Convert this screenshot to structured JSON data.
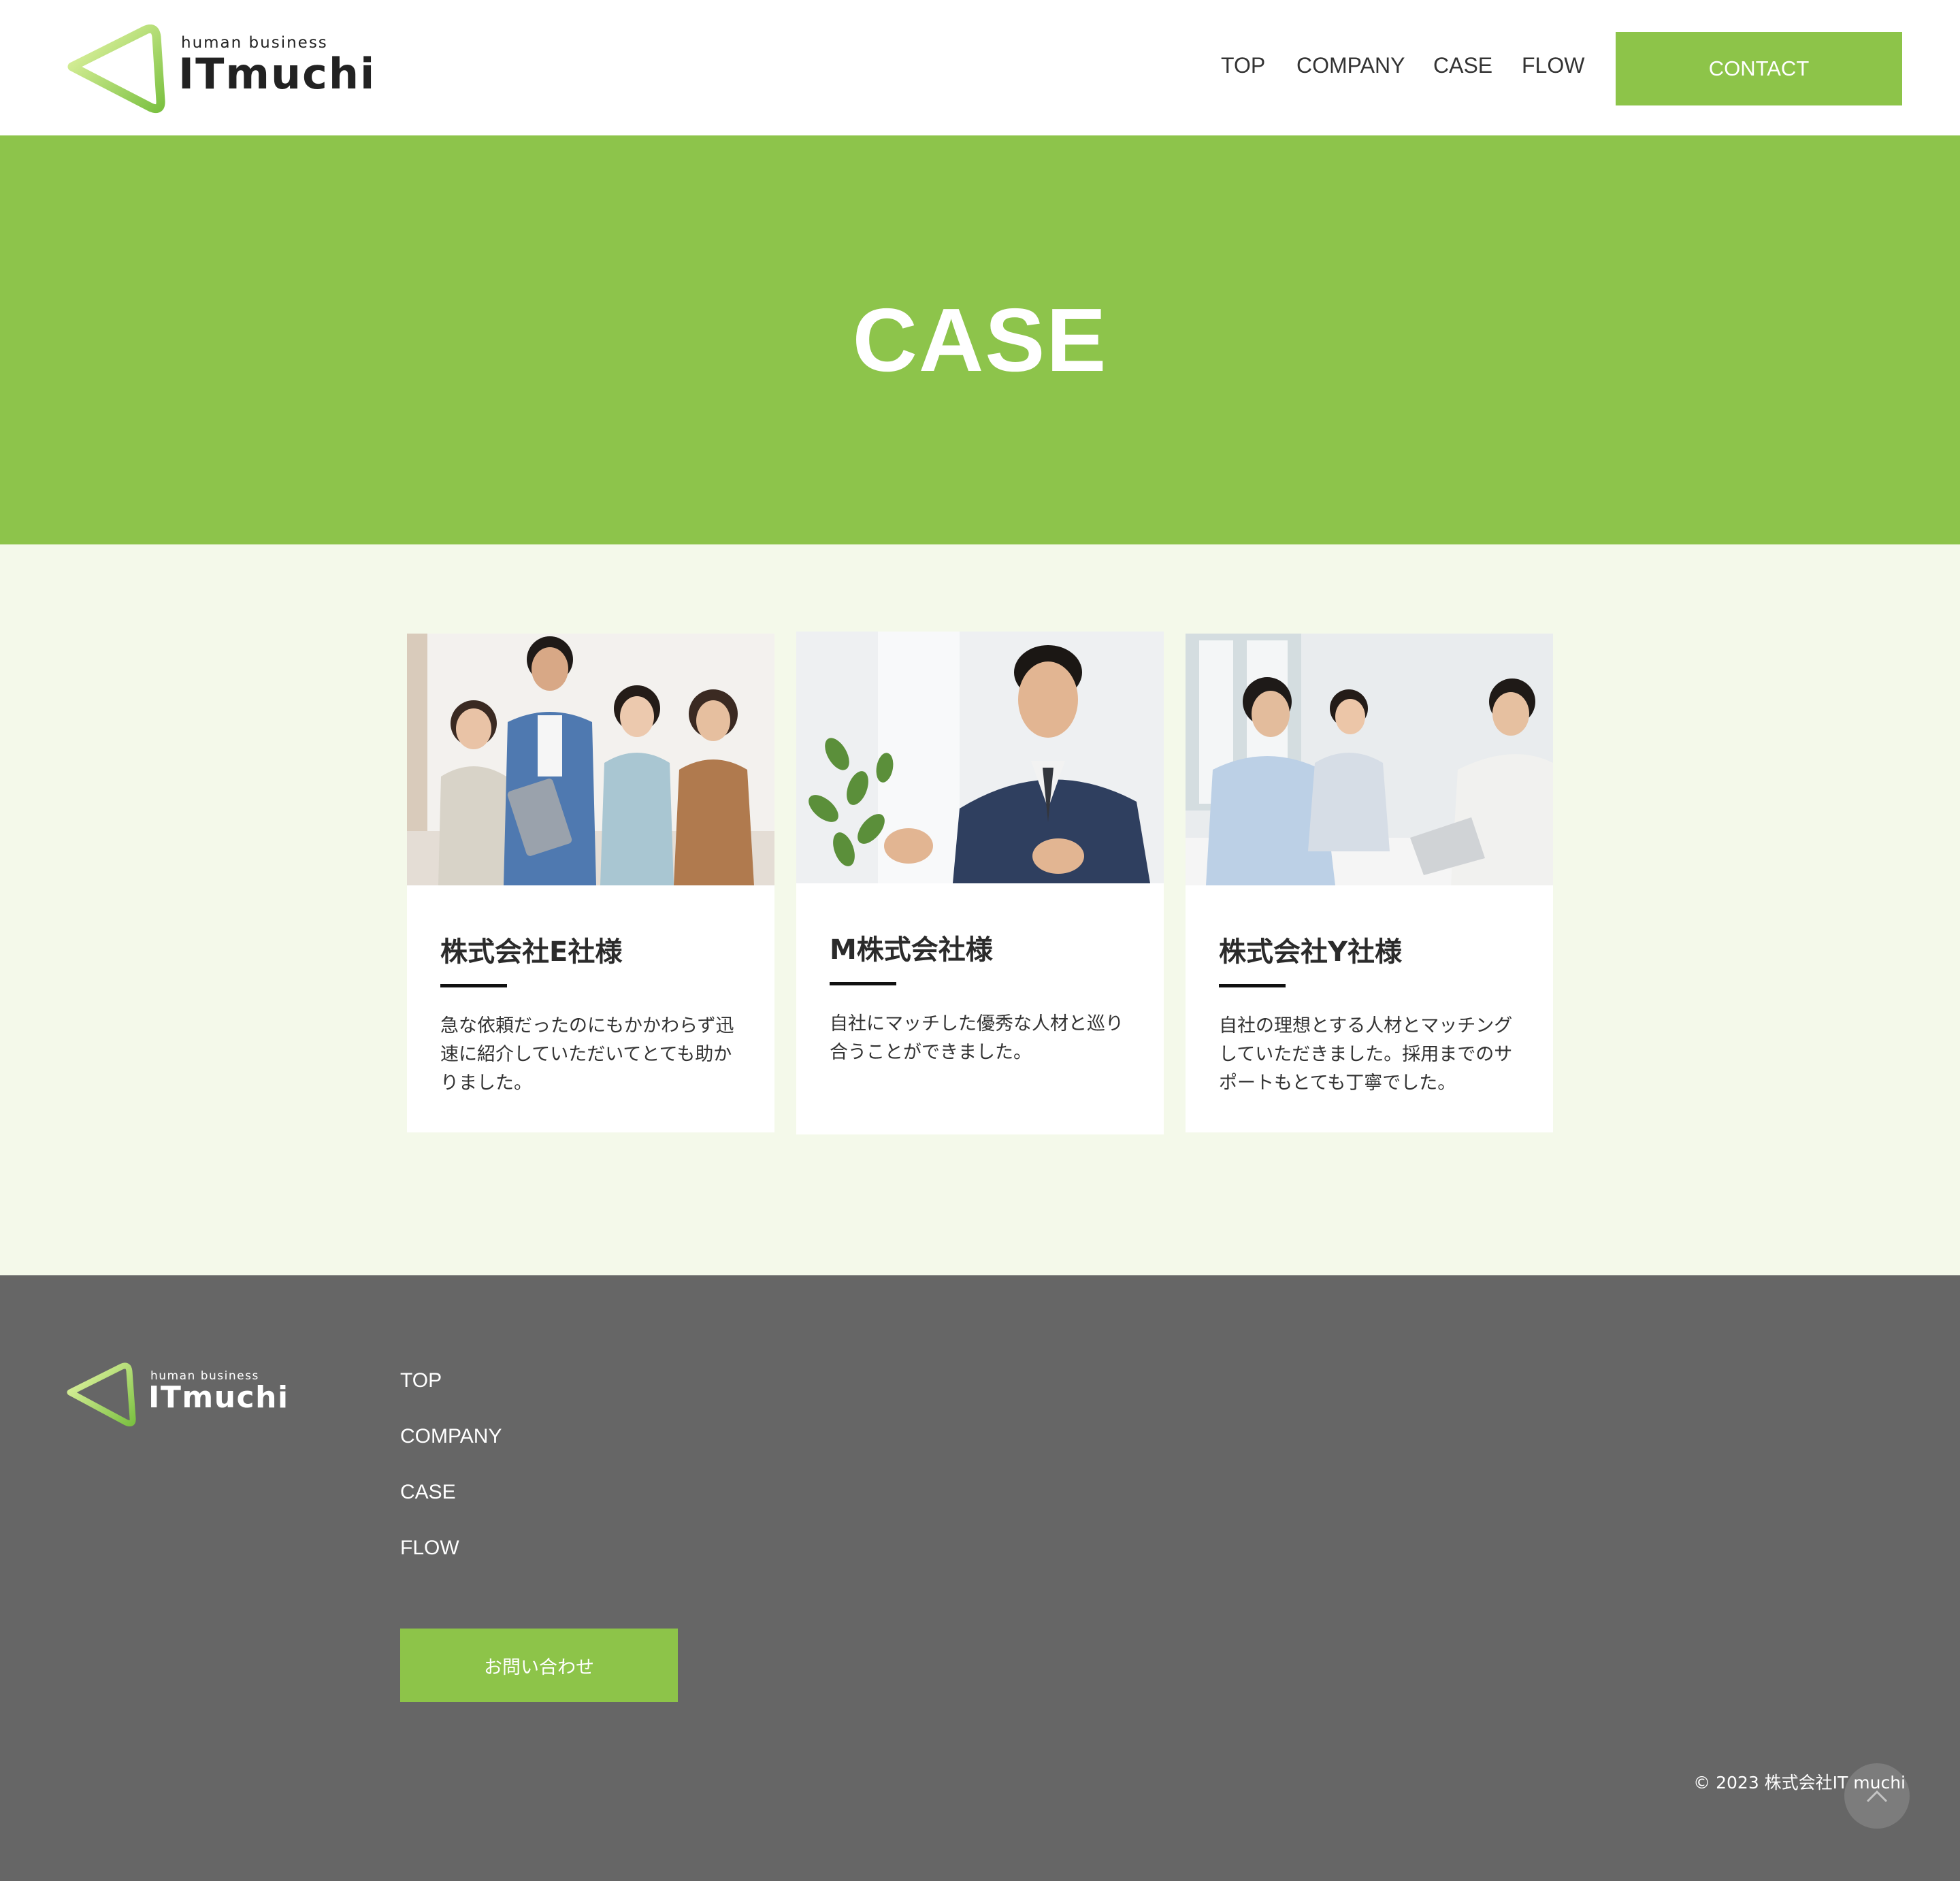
{
  "header": {
    "logo": {
      "sub": "human business",
      "main": "ITmuchi"
    },
    "nav": [
      {
        "label": "TOP"
      },
      {
        "label": "COMPANY"
      },
      {
        "label": "CASE"
      },
      {
        "label": "FLOW"
      }
    ],
    "contact_label": "CONTACT"
  },
  "hero": {
    "title": "CASE"
  },
  "cases": [
    {
      "title": "株式会社E社様",
      "text": "急な依頼だったのにもかかわらず迅速に紹介していただいてとても助かりました。",
      "photo": "group-of-four-staff-photo"
    },
    {
      "title": "M株式会社様",
      "text": "自社にマッチした優秀な人材と巡り合うことができました。",
      "photo": "businessman-talking-photo"
    },
    {
      "title": "株式会社Y社様",
      "text": "自社の理想とする人材とマッチングしていただきました。採用までのサポートもとても丁寧でした。",
      "photo": "meeting-with-laptop-photo"
    }
  ],
  "footer": {
    "logo": {
      "sub": "human business",
      "main": "ITmuchi"
    },
    "links": [
      {
        "label": "TOP"
      },
      {
        "label": "COMPANY"
      },
      {
        "label": "CASE"
      },
      {
        "label": "FLOW"
      }
    ],
    "contact_button": "お問い合わせ",
    "copyright": "© 2023 株式会社IT muchi"
  },
  "colors": {
    "accent": "#8dc449",
    "hero_bg": "#8dc44b",
    "content_bg": "#f4f9ea",
    "footer_bg": "#666666"
  }
}
